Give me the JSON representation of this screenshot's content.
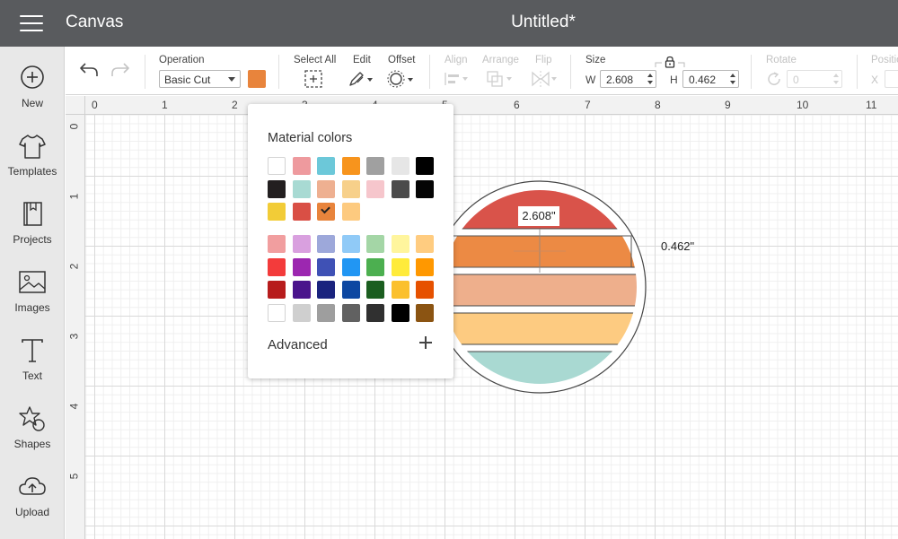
{
  "header": {
    "menu_icon": "hamburger-icon",
    "app_title": "Canvas",
    "doc_title": "Untitled*"
  },
  "sidebar": {
    "items": [
      {
        "label": "New",
        "icon": "plus-circle-icon"
      },
      {
        "label": "Templates",
        "icon": "tshirt-icon"
      },
      {
        "label": "Projects",
        "icon": "book-icon"
      },
      {
        "label": "Images",
        "icon": "image-icon"
      },
      {
        "label": "Text",
        "icon": "text-icon"
      },
      {
        "label": "Shapes",
        "icon": "shapes-icon"
      },
      {
        "label": "Upload",
        "icon": "cloud-upload-icon"
      }
    ]
  },
  "toolbar": {
    "operation_label": "Operation",
    "operation_value": "Basic Cut",
    "operation_color": "#E8843C",
    "select_all_label": "Select All",
    "edit_label": "Edit",
    "offset_label": "Offset",
    "align_label": "Align",
    "arrange_label": "Arrange",
    "flip_label": "Flip",
    "size_label": "Size",
    "w_label": "W",
    "w_value": "2.608",
    "h_label": "H",
    "h_value": "0.462",
    "rotate_label": "Rotate",
    "rotate_value": "0",
    "position_label": "Positio",
    "x_label": "X"
  },
  "ruler": {
    "top": [
      "0",
      "1",
      "2",
      "3",
      "4",
      "5",
      "6",
      "7",
      "8",
      "9",
      "10",
      "11"
    ],
    "left": [
      "0",
      "1",
      "2",
      "3",
      "4",
      "5"
    ]
  },
  "color_popup": {
    "title": "Material colors",
    "basic_rows": [
      [
        "#FFFFFF",
        "#EE9A9E",
        "#6CC8D9",
        "#F7941D",
        "#A0A0A0",
        "#E6E6E6",
        "#000000"
      ],
      [
        "#231F20",
        "#A8DAD3",
        "#EEB091",
        "#F7D08A",
        "#F6C6CC",
        "#4B4B4B",
        "#050505"
      ],
      [
        "#F2CC37",
        "#D94F45",
        "#E8843C",
        "#FDCA7F"
      ]
    ],
    "selected_color": "#E8843C",
    "palette_rows": [
      [
        "#F19E9F",
        "#D9A0DF",
        "#9DA8DA",
        "#90CAF7",
        "#A4D6A6",
        "#FFF59D",
        "#FFCC80"
      ],
      [
        "#F33B3B",
        "#9C27B0",
        "#3F51B5",
        "#2196F3",
        "#4CAF50",
        "#FFEB3B",
        "#FF9800"
      ],
      [
        "#B71C1C",
        "#4A148C",
        "#1A237E",
        "#0D47A1",
        "#1B5E20",
        "#FBC02D",
        "#E65100"
      ],
      [
        "#FFFFFF",
        "#CFCFCF",
        "#9E9E9E",
        "#616161",
        "#303030",
        "#000000",
        "#8B5412"
      ]
    ],
    "advanced_label": "Advanced",
    "advanced_icon": "plus-icon"
  },
  "design": {
    "stripe_colors": [
      "#D9534A",
      "#EC8A44",
      "#EEAF8C",
      "#FDCB81",
      "#A9D9D2"
    ],
    "width_readout": "2.608\"",
    "height_readout": "0.462\""
  }
}
